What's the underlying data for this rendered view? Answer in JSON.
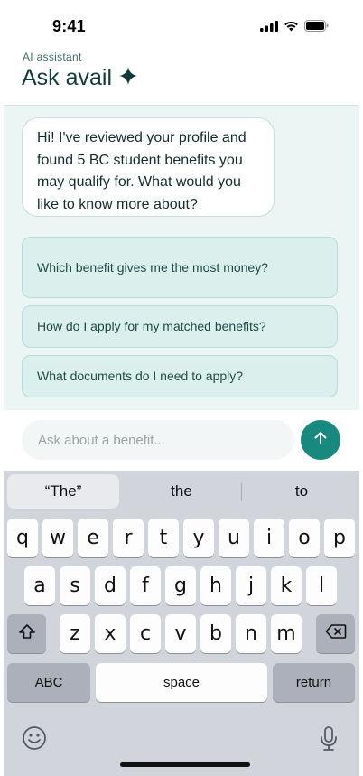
{
  "status_bar": {
    "time": "9:41",
    "icons": [
      "signal-icon",
      "wifi-icon",
      "battery-icon"
    ]
  },
  "header": {
    "subtitle": "AI assistant",
    "title": "Ask avail",
    "title_icon": "sparkle-icon"
  },
  "chat": {
    "assistant_message": "Hi! I've reviewed your profile and found 5 BC student benefits you may qualify for. What would you like to know more about?",
    "suggestions": [
      "Which benefit gives me the most money?",
      "How do I apply for my matched benefits?",
      "What documents do I need to apply?"
    ]
  },
  "composer": {
    "placeholder": "Ask about a benefit...",
    "send_icon": "arrow-up-icon"
  },
  "keyboard": {
    "predictions": [
      "“The”",
      "the",
      "to"
    ],
    "row1": [
      "q",
      "w",
      "e",
      "r",
      "t",
      "y",
      "u",
      "i",
      "o",
      "p"
    ],
    "row2": [
      "a",
      "s",
      "d",
      "f",
      "g",
      "h",
      "j",
      "k",
      "l"
    ],
    "row3": [
      "z",
      "x",
      "c",
      "v",
      "b",
      "n",
      "m"
    ],
    "abc_label": "ABC",
    "space_label": "space",
    "return_label": "return",
    "icons": [
      "shift-icon",
      "backspace-icon",
      "emoji-icon",
      "microphone-icon"
    ]
  },
  "colors": {
    "accent": "#17897f",
    "chat_background": "#eaf5f4",
    "suggestion_background": "#dbefed",
    "title_color": "#0f3b38",
    "keyboard_background": "#d1d4db"
  }
}
